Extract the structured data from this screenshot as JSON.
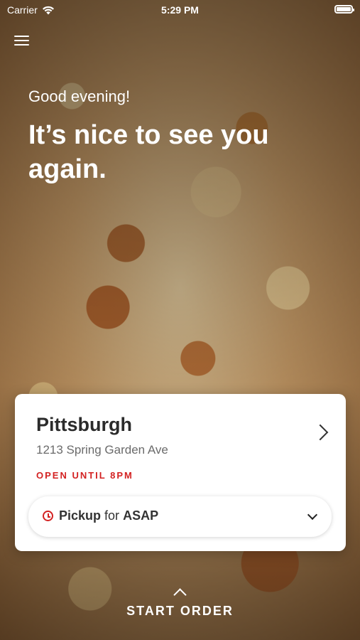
{
  "status_bar": {
    "carrier": "Carrier",
    "time": "5:29 PM",
    "wifi_icon": "wifi-icon",
    "battery_icon": "battery-icon"
  },
  "header": {
    "menu_icon": "hamburger-menu-icon",
    "greeting": "Good evening!",
    "headline": "It’s nice to see you again."
  },
  "location_card": {
    "name": "Pittsburgh",
    "address": "1213 Spring Garden Ave",
    "status": "OPEN UNTIL 8PM",
    "status_color": "#d32222",
    "pickup": {
      "icon": "clock-icon",
      "mode": "Pickup",
      "connector": "for",
      "time": "ASAP"
    }
  },
  "footer": {
    "start_label": "START ORDER"
  }
}
